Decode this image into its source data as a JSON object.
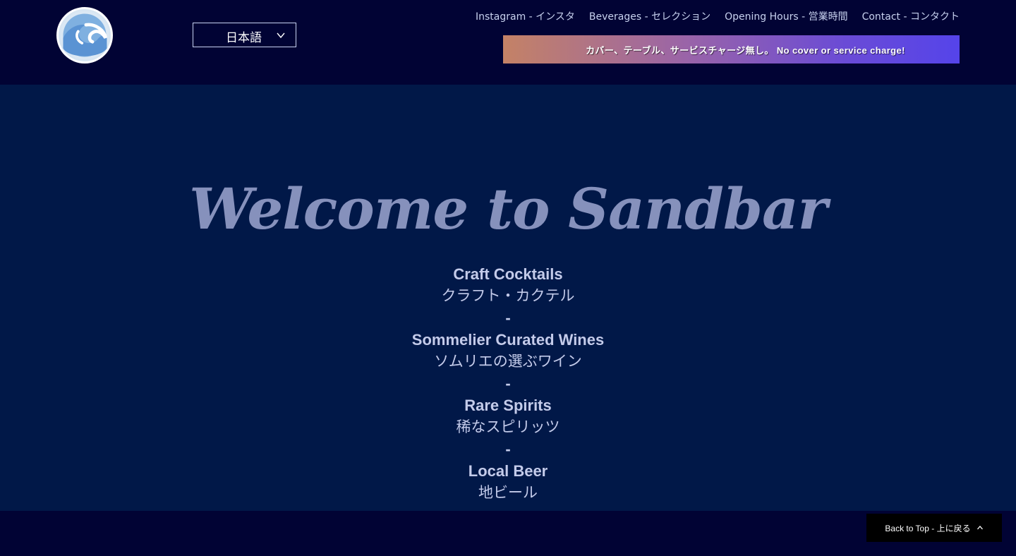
{
  "header": {
    "logo": {
      "icon": "wave-logo-icon"
    },
    "language_selector": {
      "value": "日本語",
      "icon": "chevron-down-icon"
    },
    "nav": [
      {
        "label": "Instagram - インスタ"
      },
      {
        "label": "Beverages - セレクション"
      },
      {
        "label": "Opening Hours - 営業時間"
      },
      {
        "label": "Contact - コンタクト"
      }
    ],
    "banner": {
      "text": "カバー、テーブル、サービスチャージ無し。 No cover or service charge!"
    }
  },
  "hero": {
    "title": "Welcome to Sandbar",
    "offerings": [
      {
        "en": "Craft Cocktails",
        "jp": "クラフト・カクテル"
      },
      {
        "en": "Sommelier Curated Wines",
        "jp": "ソムリエの選ぶワイン"
      },
      {
        "en": "Rare Spirits",
        "jp": "稀なスピリッツ"
      },
      {
        "en": "Local Beer",
        "jp": "地ビール"
      }
    ],
    "separator": "-"
  },
  "back_to_top": {
    "label": "Back to Top - 上に戻る",
    "icon": "chevron-up-icon"
  },
  "colors": {
    "header_bg": "#010334",
    "hero_bg": "#011848",
    "title": "#8691bc",
    "text": "#c4cbea",
    "banner_start": "#c48266",
    "banner_end": "#5544ea"
  }
}
